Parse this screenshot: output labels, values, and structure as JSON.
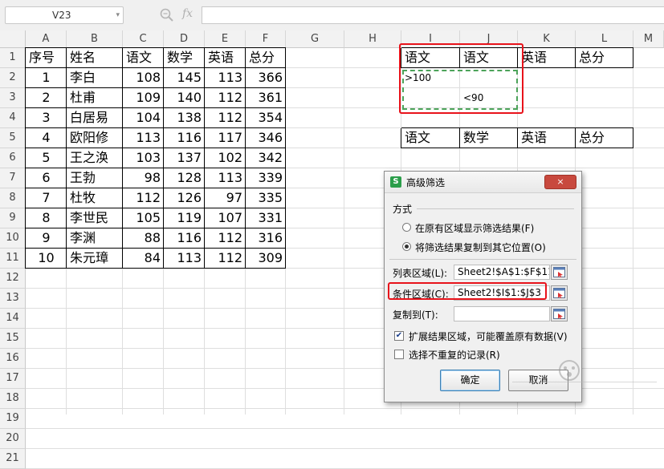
{
  "formula_bar": {
    "name_box": "V23",
    "fx": "fx",
    "formula": ""
  },
  "columns": [
    "A",
    "B",
    "C",
    "D",
    "E",
    "F",
    "G",
    "H",
    "I",
    "J",
    "K",
    "L",
    "M"
  ],
  "rows": [
    "1",
    "2",
    "3",
    "4",
    "5",
    "6",
    "7",
    "8",
    "9",
    "10",
    "11",
    "12",
    "13",
    "14",
    "15",
    "16",
    "17",
    "18",
    "19",
    "20",
    "21"
  ],
  "table": {
    "headers": [
      "序号",
      "姓名",
      "语文",
      "数学",
      "英语",
      "总分"
    ],
    "rows": [
      [
        "1",
        "李白",
        "108",
        "145",
        "113",
        "366"
      ],
      [
        "2",
        "杜甫",
        "109",
        "140",
        "112",
        "361"
      ],
      [
        "3",
        "白居易",
        "104",
        "138",
        "112",
        "354"
      ],
      [
        "4",
        "欧阳修",
        "113",
        "116",
        "117",
        "346"
      ],
      [
        "5",
        "王之涣",
        "103",
        "137",
        "102",
        "342"
      ],
      [
        "6",
        "王勃",
        "98",
        "128",
        "113",
        "339"
      ],
      [
        "7",
        "杜牧",
        "112",
        "126",
        "97",
        "335"
      ],
      [
        "8",
        "李世民",
        "105",
        "119",
        "107",
        "331"
      ],
      [
        "9",
        "李渊",
        "88",
        "116",
        "112",
        "316"
      ],
      [
        "10",
        "朱元璋",
        "84",
        "113",
        "112",
        "309"
      ]
    ]
  },
  "criteria": {
    "headers": [
      "语文",
      "语文",
      "英语",
      "总分"
    ],
    "row2": ">100",
    "row3": "<90"
  },
  "output_headers": [
    "语文",
    "数学",
    "英语",
    "总分"
  ],
  "dialog": {
    "logo": "S",
    "title": "高级筛选",
    "close_label": "×",
    "section_label": "方式",
    "option1": "在原有区域显示筛选结果(F)",
    "option2": "将筛选结果复制到其它位置(O)",
    "list_range_label": "列表区域(L):",
    "list_range_value": "Sheet2!$A$1:$F$11",
    "criteria_range_label": "条件区域(C):",
    "criteria_range_value": "Sheet2!$I$1:$J$3",
    "copy_to_label": "复制到(T):",
    "copy_to_value": "",
    "expand_label": "扩展结果区域，可能覆盖原有数据(V)",
    "unique_label": "选择不重复的记录(R)",
    "ok_label": "确定",
    "cancel_label": "取消"
  },
  "colors": {
    "highlight_red": "#e8131b",
    "selection_green": "#4ca35a",
    "grid_line": "#dedede"
  }
}
